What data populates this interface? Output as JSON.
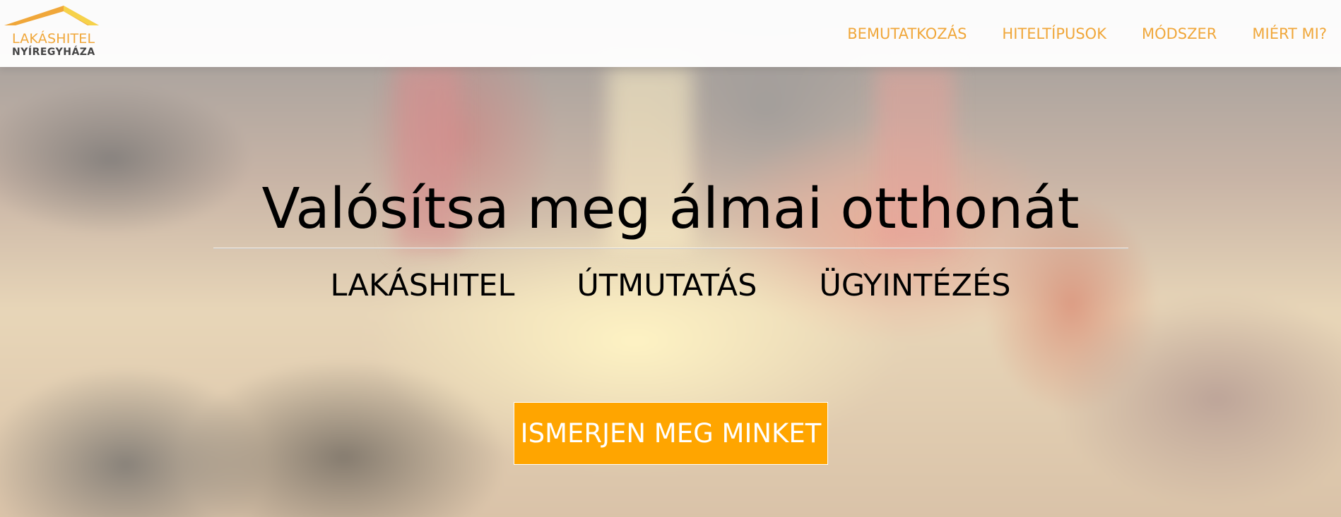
{
  "brand": {
    "line1": "LAKÁSHITEL",
    "line2": "NYÍREGYHÁZA",
    "accent_color": "#f0a73a",
    "roof_colors": [
      "#f0a73a",
      "#f6d24a"
    ]
  },
  "nav": {
    "items": [
      {
        "label": "BEMUTATKOZÁS"
      },
      {
        "label": "HITELTÍPUSOK"
      },
      {
        "label": "MÓDSZER"
      },
      {
        "label": "MIÉRT MI?"
      }
    ]
  },
  "hero": {
    "title": "Valósítsa meg álmai otthonát",
    "subtitles": [
      "LAKÁSHITEL",
      "ÚTMUTATÁS",
      "ÜGYINTÉZÉS"
    ],
    "cta_label": "ISMERJEN MEG MINKET",
    "cta_color": "#ffa500"
  }
}
